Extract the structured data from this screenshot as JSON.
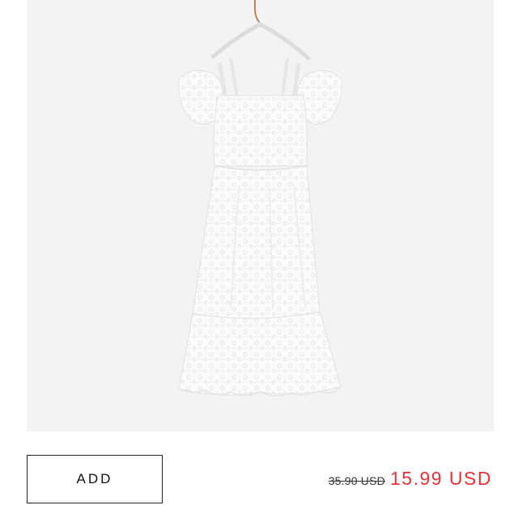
{
  "product": {
    "image_alt": "white lace dress on hanger",
    "image_background": "#f3f3f3"
  },
  "actions": {
    "add_label": "ADD"
  },
  "pricing": {
    "original_price": "35.90 USD",
    "sale_price": "15.99 USD",
    "sale_color": "#e5333a"
  }
}
